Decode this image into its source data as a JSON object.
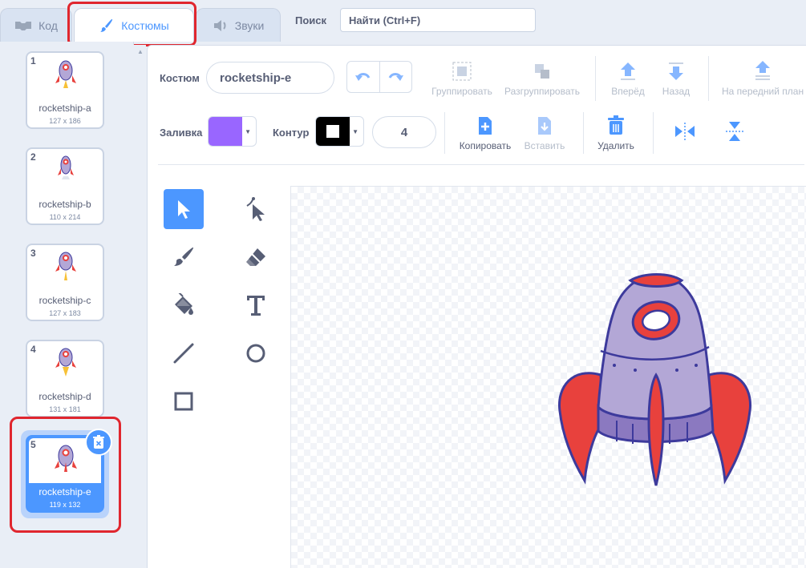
{
  "tabs": [
    {
      "label": "Код",
      "icon": "code-blocks-icon"
    },
    {
      "label": "Костюмы",
      "icon": "paintbrush-icon",
      "active": true
    },
    {
      "label": "Звуки",
      "icon": "speaker-icon"
    }
  ],
  "search": {
    "label": "Поиск",
    "value": "Найти (Ctrl+F)"
  },
  "costumes": [
    {
      "num": "1",
      "name": "rocketship-a",
      "size": "127 x 186"
    },
    {
      "num": "2",
      "name": "rocketship-b",
      "size": "110 x 214"
    },
    {
      "num": "3",
      "name": "rocketship-c",
      "size": "127 x 183"
    },
    {
      "num": "4",
      "name": "rocketship-d",
      "size": "131 x 181"
    },
    {
      "num": "5",
      "name": "rocketship-e",
      "size": "119 x 132",
      "selected": true
    }
  ],
  "toolbar": {
    "costume_label": "Костюм",
    "costume_name": "rocketship-e",
    "group": "Группировать",
    "ungroup": "Разгруппировать",
    "forward": "Вперёд",
    "backward": "Назад",
    "front": "На передний план",
    "fill_label": "Заливка",
    "outline_label": "Контур",
    "outline_width": "4",
    "copy": "Копировать",
    "paste": "Вставить",
    "delete": "Удалить"
  },
  "colors": {
    "accent": "#4c97ff",
    "fill": "#9966ff",
    "outline": "#000000",
    "highlight": "#e0262e",
    "rocket_body": "#b3a7d6",
    "rocket_fins": "#e8413d",
    "rocket_stroke": "#3d3a9c"
  },
  "tools": [
    "select-icon",
    "reshape-icon",
    "brush-icon",
    "eraser-icon",
    "fill-bucket-icon",
    "text-tool-icon",
    "line-icon",
    "circle-icon",
    "rectangle-icon"
  ]
}
